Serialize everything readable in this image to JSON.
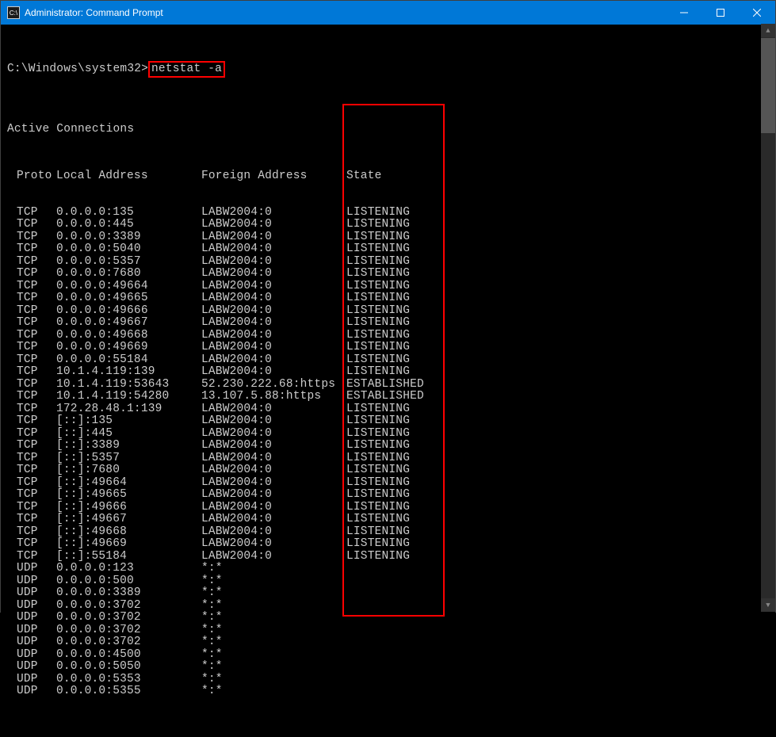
{
  "window": {
    "title": "Administrator: Command Prompt"
  },
  "prompt": {
    "path": "C:\\Windows\\system32>",
    "command": "netstat -a"
  },
  "section_title": "Active Connections",
  "headers": {
    "proto": "Proto",
    "local": "Local Address",
    "foreign": "Foreign Address",
    "state": "State"
  },
  "connections": [
    {
      "proto": "TCP",
      "local": "0.0.0.0:135",
      "foreign": "LABW2004:0",
      "state": "LISTENING"
    },
    {
      "proto": "TCP",
      "local": "0.0.0.0:445",
      "foreign": "LABW2004:0",
      "state": "LISTENING"
    },
    {
      "proto": "TCP",
      "local": "0.0.0.0:3389",
      "foreign": "LABW2004:0",
      "state": "LISTENING"
    },
    {
      "proto": "TCP",
      "local": "0.0.0.0:5040",
      "foreign": "LABW2004:0",
      "state": "LISTENING"
    },
    {
      "proto": "TCP",
      "local": "0.0.0.0:5357",
      "foreign": "LABW2004:0",
      "state": "LISTENING"
    },
    {
      "proto": "TCP",
      "local": "0.0.0.0:7680",
      "foreign": "LABW2004:0",
      "state": "LISTENING"
    },
    {
      "proto": "TCP",
      "local": "0.0.0.0:49664",
      "foreign": "LABW2004:0",
      "state": "LISTENING"
    },
    {
      "proto": "TCP",
      "local": "0.0.0.0:49665",
      "foreign": "LABW2004:0",
      "state": "LISTENING"
    },
    {
      "proto": "TCP",
      "local": "0.0.0.0:49666",
      "foreign": "LABW2004:0",
      "state": "LISTENING"
    },
    {
      "proto": "TCP",
      "local": "0.0.0.0:49667",
      "foreign": "LABW2004:0",
      "state": "LISTENING"
    },
    {
      "proto": "TCP",
      "local": "0.0.0.0:49668",
      "foreign": "LABW2004:0",
      "state": "LISTENING"
    },
    {
      "proto": "TCP",
      "local": "0.0.0.0:49669",
      "foreign": "LABW2004:0",
      "state": "LISTENING"
    },
    {
      "proto": "TCP",
      "local": "0.0.0.0:55184",
      "foreign": "LABW2004:0",
      "state": "LISTENING"
    },
    {
      "proto": "TCP",
      "local": "10.1.4.119:139",
      "foreign": "LABW2004:0",
      "state": "LISTENING"
    },
    {
      "proto": "TCP",
      "local": "10.1.4.119:53643",
      "foreign": "52.230.222.68:https",
      "state": "ESTABLISHED"
    },
    {
      "proto": "TCP",
      "local": "10.1.4.119:54280",
      "foreign": "13.107.5.88:https",
      "state": "ESTABLISHED"
    },
    {
      "proto": "TCP",
      "local": "172.28.48.1:139",
      "foreign": "LABW2004:0",
      "state": "LISTENING"
    },
    {
      "proto": "TCP",
      "local": "[::]:135",
      "foreign": "LABW2004:0",
      "state": "LISTENING"
    },
    {
      "proto": "TCP",
      "local": "[::]:445",
      "foreign": "LABW2004:0",
      "state": "LISTENING"
    },
    {
      "proto": "TCP",
      "local": "[::]:3389",
      "foreign": "LABW2004:0",
      "state": "LISTENING"
    },
    {
      "proto": "TCP",
      "local": "[::]:5357",
      "foreign": "LABW2004:0",
      "state": "LISTENING"
    },
    {
      "proto": "TCP",
      "local": "[::]:7680",
      "foreign": "LABW2004:0",
      "state": "LISTENING"
    },
    {
      "proto": "TCP",
      "local": "[::]:49664",
      "foreign": "LABW2004:0",
      "state": "LISTENING"
    },
    {
      "proto": "TCP",
      "local": "[::]:49665",
      "foreign": "LABW2004:0",
      "state": "LISTENING"
    },
    {
      "proto": "TCP",
      "local": "[::]:49666",
      "foreign": "LABW2004:0",
      "state": "LISTENING"
    },
    {
      "proto": "TCP",
      "local": "[::]:49667",
      "foreign": "LABW2004:0",
      "state": "LISTENING"
    },
    {
      "proto": "TCP",
      "local": "[::]:49668",
      "foreign": "LABW2004:0",
      "state": "LISTENING"
    },
    {
      "proto": "TCP",
      "local": "[::]:49669",
      "foreign": "LABW2004:0",
      "state": "LISTENING"
    },
    {
      "proto": "TCP",
      "local": "[::]:55184",
      "foreign": "LABW2004:0",
      "state": "LISTENING"
    },
    {
      "proto": "UDP",
      "local": "0.0.0.0:123",
      "foreign": "*:*",
      "state": ""
    },
    {
      "proto": "UDP",
      "local": "0.0.0.0:500",
      "foreign": "*:*",
      "state": ""
    },
    {
      "proto": "UDP",
      "local": "0.0.0.0:3389",
      "foreign": "*:*",
      "state": ""
    },
    {
      "proto": "UDP",
      "local": "0.0.0.0:3702",
      "foreign": "*:*",
      "state": ""
    },
    {
      "proto": "UDP",
      "local": "0.0.0.0:3702",
      "foreign": "*:*",
      "state": ""
    },
    {
      "proto": "UDP",
      "local": "0.0.0.0:3702",
      "foreign": "*:*",
      "state": ""
    },
    {
      "proto": "UDP",
      "local": "0.0.0.0:3702",
      "foreign": "*:*",
      "state": ""
    },
    {
      "proto": "UDP",
      "local": "0.0.0.0:4500",
      "foreign": "*:*",
      "state": ""
    },
    {
      "proto": "UDP",
      "local": "0.0.0.0:5050",
      "foreign": "*:*",
      "state": ""
    },
    {
      "proto": "UDP",
      "local": "0.0.0.0:5353",
      "foreign": "*:*",
      "state": ""
    },
    {
      "proto": "UDP",
      "local": "0.0.0.0:5355",
      "foreign": "*:*",
      "state": ""
    }
  ]
}
